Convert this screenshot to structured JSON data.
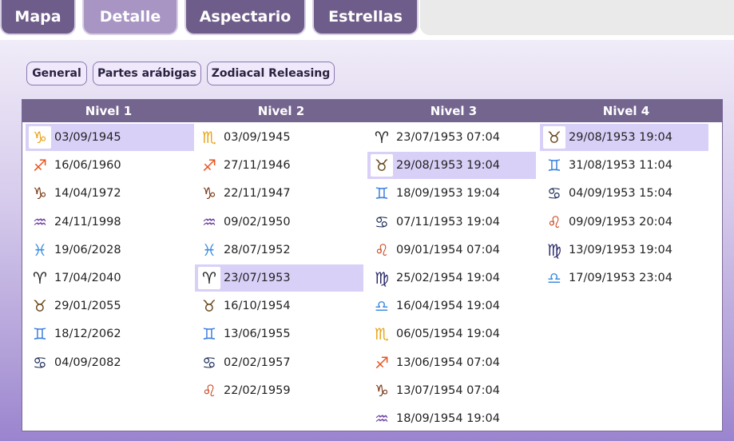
{
  "tabs": [
    {
      "label": "Mapa"
    },
    {
      "label": "Detalle"
    },
    {
      "label": "Aspectario"
    },
    {
      "label": "Estrellas"
    }
  ],
  "subtabs": [
    {
      "label": "General"
    },
    {
      "label": "Partes arábigas"
    },
    {
      "label": "Zodiacal Releasing"
    }
  ],
  "columns": [
    {
      "header": "Nivel 1",
      "rows": [
        {
          "sign": "♑",
          "icon": "capricorn-icon",
          "color": "#e8a317",
          "date": "03/09/1945",
          "selected": true
        },
        {
          "sign": "♐",
          "icon": "sagittarius-icon",
          "color": "#e8531f",
          "date": "16/06/1960"
        },
        {
          "sign": "♑",
          "icon": "capricorn-icon",
          "color": "#7a3a1a",
          "date": "14/04/1972"
        },
        {
          "sign": "♒",
          "icon": "aquarius-icon",
          "color": "#6a3ea0",
          "date": "24/11/1998"
        },
        {
          "sign": "♓",
          "icon": "pisces-icon",
          "color": "#3d8fe0",
          "date": "19/06/2028"
        },
        {
          "sign": "♈",
          "icon": "aries-icon",
          "color": "#222222",
          "date": "17/04/2040"
        },
        {
          "sign": "♉",
          "icon": "taurus-icon",
          "color": "#6b4a1f",
          "date": "29/01/2055"
        },
        {
          "sign": "♊",
          "icon": "gemini-icon",
          "color": "#3d7fe0",
          "date": "18/12/2062"
        },
        {
          "sign": "♋",
          "icon": "cancer-icon",
          "color": "#1f2f5a",
          "date": "04/09/2082"
        }
      ]
    },
    {
      "header": "Nivel 2",
      "rows": [
        {
          "sign": "♏",
          "icon": "scorpio-icon",
          "color": "#e8a317",
          "date": "03/09/1945"
        },
        {
          "sign": "♐",
          "icon": "sagittarius-icon",
          "color": "#e8531f",
          "date": "27/11/1946"
        },
        {
          "sign": "♑",
          "icon": "capricorn-icon",
          "color": "#7a3a1a",
          "date": "22/11/1947"
        },
        {
          "sign": "♒",
          "icon": "aquarius-icon",
          "color": "#6a3ea0",
          "date": "09/02/1950"
        },
        {
          "sign": "♓",
          "icon": "pisces-icon",
          "color": "#3d8fe0",
          "date": "28/07/1952"
        },
        {
          "sign": "♈",
          "icon": "aries-icon",
          "color": "#222222",
          "date": "23/07/1953",
          "selected": true
        },
        {
          "sign": "♉",
          "icon": "taurus-icon",
          "color": "#6b4a1f",
          "date": "16/10/1954"
        },
        {
          "sign": "♊",
          "icon": "gemini-icon",
          "color": "#3d7fe0",
          "date": "13/06/1955"
        },
        {
          "sign": "♋",
          "icon": "cancer-icon",
          "color": "#1f2f5a",
          "date": "02/02/1957"
        },
        {
          "sign": "♌",
          "icon": "leo-icon",
          "color": "#c8421a",
          "date": "22/02/1959"
        }
      ]
    },
    {
      "header": "Nivel 3",
      "rows": [
        {
          "sign": "♈",
          "icon": "aries-icon",
          "color": "#222222",
          "date": "23/07/1953 07:04"
        },
        {
          "sign": "♉",
          "icon": "taurus-icon",
          "color": "#6b4a1f",
          "date": "29/08/1953 19:04",
          "selected": true
        },
        {
          "sign": "♊",
          "icon": "gemini-icon",
          "color": "#3d7fe0",
          "date": "18/09/1953 19:04"
        },
        {
          "sign": "♋",
          "icon": "cancer-icon",
          "color": "#1f2f5a",
          "date": "07/11/1953 19:04"
        },
        {
          "sign": "♌",
          "icon": "leo-icon",
          "color": "#c8421a",
          "date": "09/01/1954 07:04"
        },
        {
          "sign": "♍",
          "icon": "virgo-icon",
          "color": "#2a2a6a",
          "date": "25/02/1954 19:04"
        },
        {
          "sign": "♎",
          "icon": "libra-icon",
          "color": "#3d8fe0",
          "date": "16/04/1954 19:04"
        },
        {
          "sign": "♏",
          "icon": "scorpio-icon",
          "color": "#e8a317",
          "date": "06/05/1954 19:04"
        },
        {
          "sign": "♐",
          "icon": "sagittarius-icon",
          "color": "#e8531f",
          "date": "13/06/1954 07:04"
        },
        {
          "sign": "♑",
          "icon": "capricorn-icon",
          "color": "#7a3a1a",
          "date": "13/07/1954 07:04"
        },
        {
          "sign": "♒",
          "icon": "aquarius-icon",
          "color": "#6a3ea0",
          "date": "18/09/1954 19:04"
        }
      ]
    },
    {
      "header": "Nivel 4",
      "rows": [
        {
          "sign": "♉",
          "icon": "taurus-icon",
          "color": "#6b4a1f",
          "date": "29/08/1953 19:04",
          "selected": true
        },
        {
          "sign": "♊",
          "icon": "gemini-icon",
          "color": "#3d7fe0",
          "date": "31/08/1953 11:04"
        },
        {
          "sign": "♋",
          "icon": "cancer-icon",
          "color": "#1f2f5a",
          "date": "04/09/1953 15:04"
        },
        {
          "sign": "♌",
          "icon": "leo-icon",
          "color": "#c8421a",
          "date": "09/09/1953 20:04"
        },
        {
          "sign": "♍",
          "icon": "virgo-icon",
          "color": "#2a2a6a",
          "date": "13/09/1953 19:04"
        },
        {
          "sign": "♎",
          "icon": "libra-icon",
          "color": "#3d8fe0",
          "date": "17/09/1953 23:04"
        }
      ]
    }
  ]
}
